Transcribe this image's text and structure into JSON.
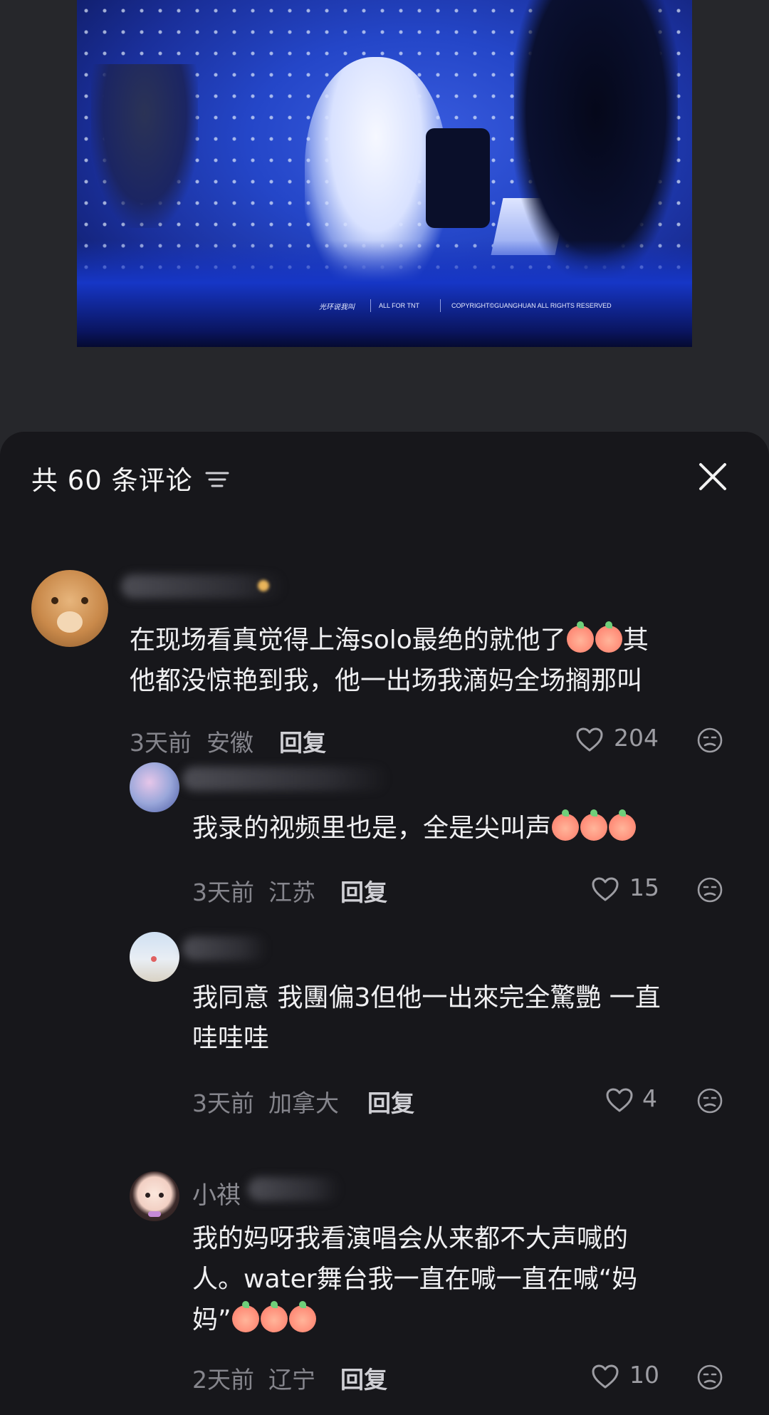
{
  "video": {
    "watermark_logo": "光环说我叫",
    "watermark_all": "ALL FOR TNT",
    "watermark_copy": "COPYRIGHT©GUANGHUAN ALL RIGHTS RESERVED"
  },
  "header": {
    "count_label": "共 60 条评论",
    "sort_icon": "sort-lines-icon",
    "close_icon": "close-x-icon"
  },
  "comments": [
    {
      "username": "",
      "line1": "在现场看真觉得上海solo最绝的就他了",
      "line1_tail": "其",
      "line2": "他都没惊艳到我，他一出场我滴妈全场搁那叫",
      "time": "3天前",
      "location": "安徽",
      "reply": "回复",
      "likes": "204"
    },
    {
      "username": "",
      "line1": "我录的视频里也是，全是尖叫声",
      "time": "3天前",
      "location": "江苏",
      "reply": "回复",
      "likes": "15"
    },
    {
      "username": "",
      "line1": "我同意 我團偏3但他一出來完全驚艷 一直",
      "line2": "哇哇哇",
      "time": "3天前",
      "location": "加拿大",
      "reply": "回复",
      "likes": "4"
    },
    {
      "username": "小祺",
      "line1": "我的妈呀我看演唱会从来都不大声喊的",
      "line2": "人。water舞台我一直在喊一直在喊“妈",
      "line3": "妈”",
      "time": "2天前",
      "location": "辽宁",
      "reply": "回复",
      "likes": "10"
    }
  ],
  "colors": {
    "sheet_bg": "#17171b",
    "page_bg": "#26272b",
    "text": "#f0f0f2",
    "muted": "#85858c"
  }
}
